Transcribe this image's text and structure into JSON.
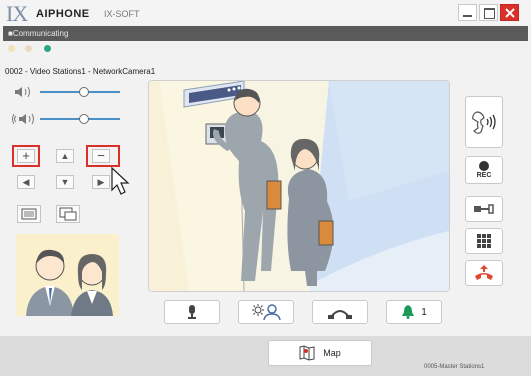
{
  "app": {
    "logo": "IX",
    "brand": "AIPHONE",
    "product": "IX-SOFT"
  },
  "status": {
    "text": "■Communicating"
  },
  "indicators": [
    {
      "name": "dot-1",
      "color": "#f2e2b8"
    },
    {
      "name": "dot-2",
      "color": "#e9dac4"
    },
    {
      "name": "dot-3",
      "color": "#2aa58a"
    }
  ],
  "station": {
    "title": "0002 - Video Stations1 - NetworkCamera1"
  },
  "volume": {
    "speaker_level": 0.55,
    "call_level": 0.55
  },
  "controls": {
    "zoom_in": "+",
    "zoom_out": "−",
    "pan_up": "▲",
    "pan_down": "▼",
    "pan_left": "◀",
    "pan_right": "▶"
  },
  "rec": {
    "label": "REC"
  },
  "door": {
    "count": "1"
  },
  "map": {
    "label": "Map"
  },
  "footer": {
    "station": "0005-Master Stations1"
  },
  "colors": {
    "accent_blue": "#4a90c8",
    "red": "#d9302a",
    "green": "#1b9a5a",
    "status_bar": "#5a5a5a"
  }
}
